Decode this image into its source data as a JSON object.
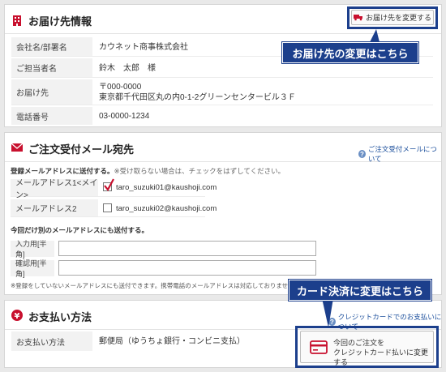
{
  "delivery": {
    "title": "お届け先情報",
    "change_button": "お届け先を変更する",
    "callout": "お届け先の変更はこちら",
    "rows": [
      {
        "label": "会社名/部署名",
        "value": "カウネット商事株式会社"
      },
      {
        "label": "ご担当者名",
        "value": "鈴木　太郎　様"
      },
      {
        "label": "お届け先",
        "value": "〒000-0000",
        "value2": "東京都千代田区丸の内0-1-2グリーンセンタービル３Ｆ"
      },
      {
        "label": "電話番号",
        "value": "03-0000-1234"
      }
    ]
  },
  "mail": {
    "title": "ご注文受付メール宛先",
    "help_link": "ご注文受付メールについて",
    "instruction_bold": "登録メールアドレスに送付する。",
    "instruction_note": "※受け取らない場合は、チェックをはずしてください。",
    "addresses": [
      {
        "label": "メールアドレス1<メイン>",
        "email": "taro_suzuki01@kaushoji.com",
        "checked": true
      },
      {
        "label": "メールアドレス2",
        "email": "taro_suzuki02@kaushoji.com",
        "checked": false
      }
    ],
    "other_heading": "今回だけ別のメールアドレスにも送付する。",
    "input_label": "入力用[半角]",
    "confirm_label": "確認用[半角]",
    "footnote": "※登録をしていないメールアドレスにも送付できます。携帯電話のメールアドレスは対応しておりません。"
  },
  "payment": {
    "title": "お支払い方法",
    "help_link": "クレジットカードでのお支払いについて",
    "label": "お支払い方法",
    "value": "郵便局（ゆうちょ銀行・コンビニ支払）",
    "card_button_line1": "今回のご注文を",
    "card_button_line2": "クレジットカード払いに変更する",
    "callout": "カード決済に変更はこちら"
  },
  "colors": {
    "accent_red": "#c8102e",
    "callout_navy": "#1c3f8c",
    "link_blue": "#1c4f9c"
  }
}
